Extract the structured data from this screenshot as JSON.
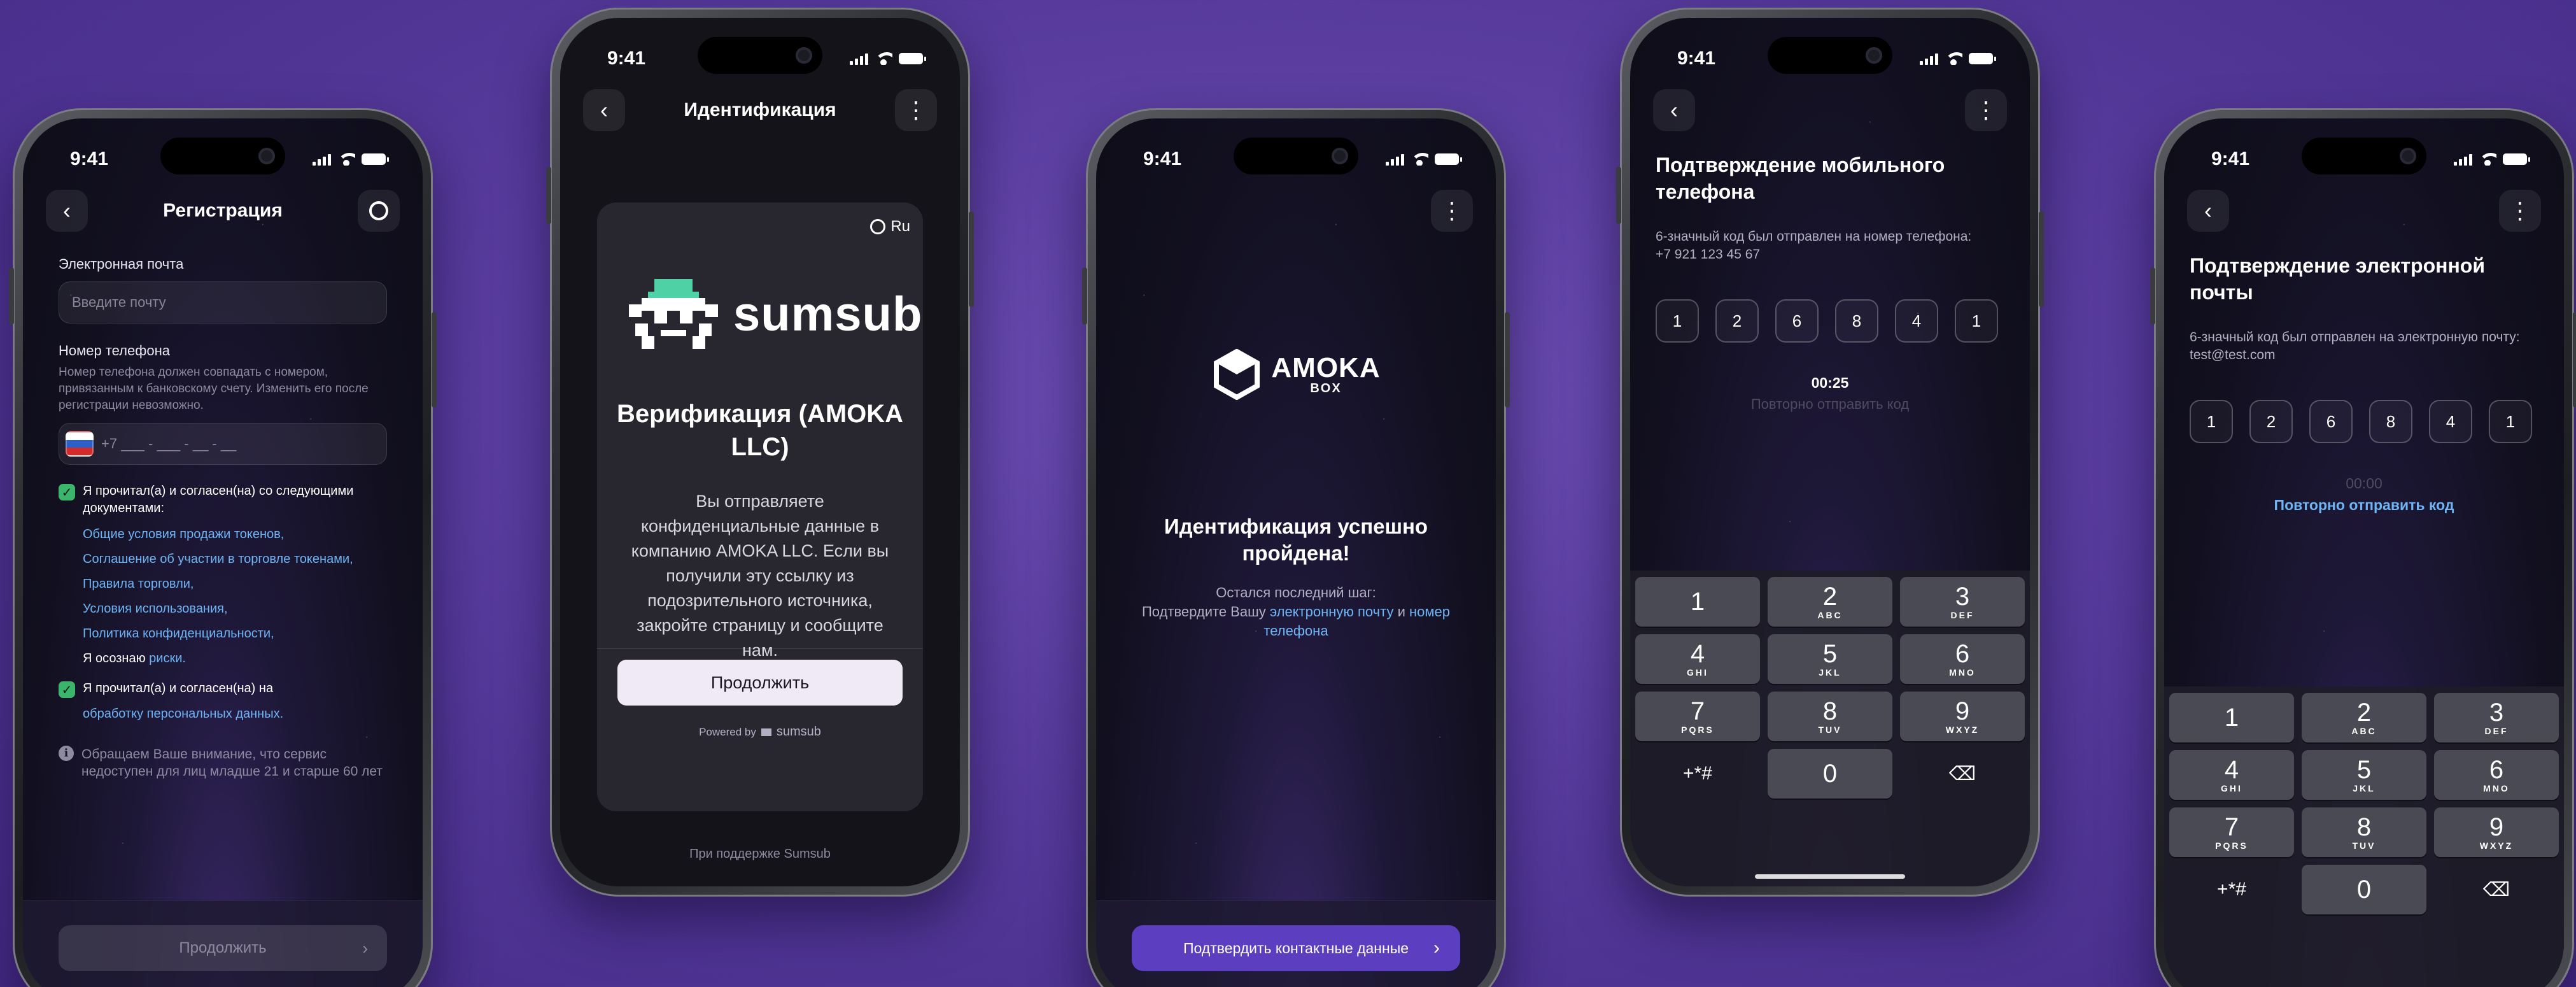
{
  "status": {
    "time": "9:41"
  },
  "screen1": {
    "title": "Регистрация",
    "email_label": "Электронная почта",
    "email_placeholder": "Введите почту",
    "phone_label": "Номер телефона",
    "phone_hint": "Номер телефона должен совпадать с номером, привязанным к банковскому счету. Изменить его после регистрации невозможно.",
    "phone_placeholder": "+7 ___ - ___ - __ - __",
    "consent1_text": "Я прочитал(а) и согласен(на) со следующими документами:",
    "links": [
      "Общие условия продажи токенов,",
      "Соглашение об участии в торговле токенами,",
      "Правила торговли,",
      "Условия использования,",
      "Политика конфиденциальности,"
    ],
    "risk_prefix": "Я осознаю",
    "risk_link": "риски.",
    "consent2_text": "Я прочитал(а) и согласен(на) на",
    "consent2_link": "обработку персональных данных.",
    "age_note": "Обращаем Ваше внимание, что сервис недоступен для лиц младше 21 и старше 60 лет",
    "continue_label": "Продолжить",
    "continue_chevron": "›"
  },
  "screen2": {
    "title": "Идентификация",
    "lang": "Ru",
    "brand": "sumsub",
    "heading": "Верификация (AMOKA LLC)",
    "body": "Вы отправляете конфиденциальные данные в компанию AMOKA LLC. Если вы получили эту ссылку из подозрительного источника, закройте страницу и сообщите нам.",
    "continue_label": "Продолжить",
    "powered_by": "Powered by",
    "powered_brand": "sumsub",
    "footer": "При поддержке Sumsub"
  },
  "screen3": {
    "logo_main": "AMOKA",
    "logo_sub": "BOX",
    "heading": "Идентификация успешно пройдена!",
    "sub1": "Остался последний шаг:",
    "sub2": "Подтвердите Вашу",
    "email_link": "электронную почту",
    "and": "и",
    "phone_link": "номер телефона",
    "confirm_label": "Подтвердить контактные данные",
    "confirm_chevron": "›"
  },
  "screen4": {
    "heading": "Подтверждение мобильного телефона",
    "sub": "6-значный код был отправлен на номер телефона:",
    "phone": "+7 921 123 45 67",
    "code": [
      "1",
      "2",
      "6",
      "8",
      "4",
      "1"
    ],
    "timer": "00:25",
    "resend": "Повторно отправить код"
  },
  "screen5": {
    "heading": "Подтверждение электронной почты",
    "sub": "6-значный код был отправлен на электронную почту:",
    "email": "test@test.com",
    "code": [
      "1",
      "2",
      "6",
      "8",
      "4",
      "1"
    ],
    "timer": "00:00",
    "resend": "Повторно отправить код"
  },
  "keypad": {
    "keys": [
      {
        "n": "1",
        "l": ""
      },
      {
        "n": "2",
        "l": "ABC"
      },
      {
        "n": "3",
        "l": "DEF"
      },
      {
        "n": "4",
        "l": "GHI"
      },
      {
        "n": "5",
        "l": "JKL"
      },
      {
        "n": "6",
        "l": "MNO"
      },
      {
        "n": "7",
        "l": "PQRS"
      },
      {
        "n": "8",
        "l": "TUV"
      },
      {
        "n": "9",
        "l": "WXYZ"
      }
    ],
    "symbols": "+*#",
    "zero": "0",
    "delete": "⌫"
  },
  "icons": {
    "back": "‹",
    "menu": "⋮",
    "globe": "🌐",
    "info": "ℹ",
    "check": "✓"
  },
  "colors": {
    "background": "#5a3d9f",
    "link": "#6fb5f5",
    "accent_button": "#5b3fc0",
    "check_green": "#3bb56b"
  }
}
